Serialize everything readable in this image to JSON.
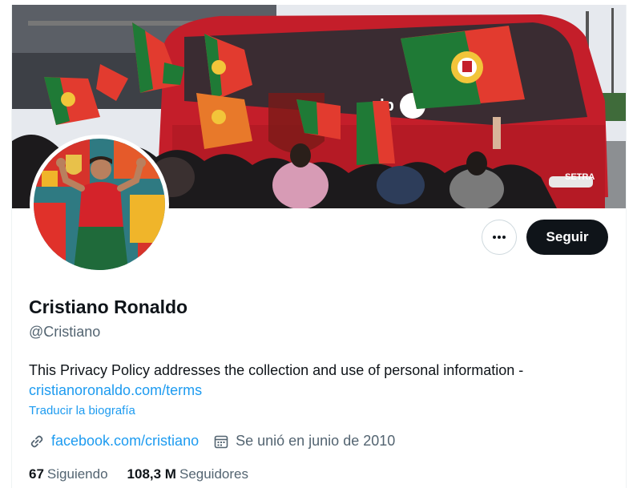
{
  "profile": {
    "name": "Cristiano Ronaldo",
    "handle": "@Cristiano",
    "bio_text": "This Privacy Policy addresses the collection and use of personal information -",
    "bio_link": "cristianoronaldo.com/terms",
    "translate_label": "Traducir la biografía",
    "website": "facebook.com/cristiano",
    "joined": "Se unió en junio de 2010",
    "following_count": "67",
    "following_label": "Siguiendo",
    "followers_count": "108,3 M",
    "followers_label": "Seguidores"
  },
  "actions": {
    "follow_label": "Seguir",
    "more_icon": "more-horizontal-icon"
  },
  "banner": {
    "bus_brand": "alp",
    "bus_model": "SETRA"
  },
  "colors": {
    "link": "#1d9bf0",
    "text": "#0f1419",
    "muted": "#536471",
    "follow_bg": "#0f1419",
    "flag_green": "#1f7a36",
    "flag_red": "#e23b2f",
    "bus_red": "#c41e2a"
  }
}
